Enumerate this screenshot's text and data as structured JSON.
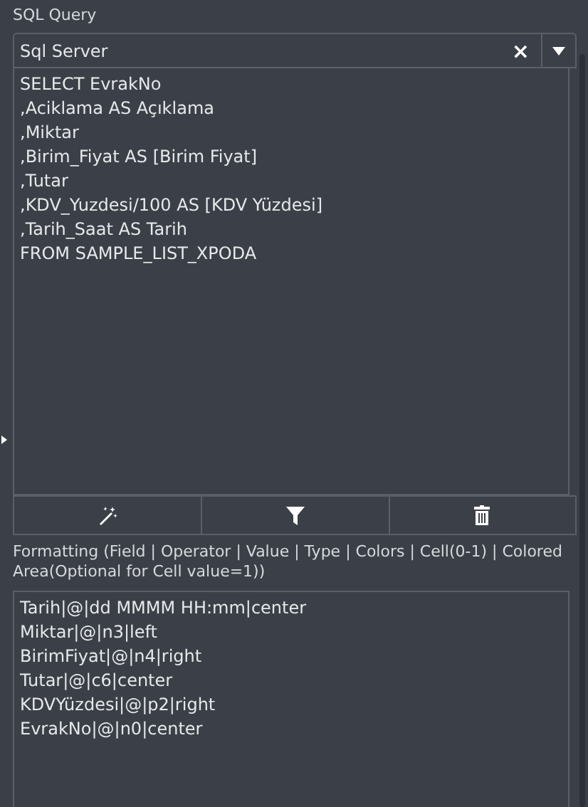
{
  "query_label": "SQL Query",
  "connection": {
    "value": "Sql Server",
    "clear": "×"
  },
  "query_lines": [
    "SELECT EvrakNo",
    ",Aciklama AS Açıklama",
    ",Miktar",
    ",Birim_Fiyat AS [Birim Fiyat]",
    ",Tutar",
    ",KDV_Yuzdesi/100 AS [KDV Yüzdesi]",
    ",Tarih_Saat AS Tarih",
    "FROM SAMPLE_LIST_XPODA"
  ],
  "toolbar": [
    {
      "kind": "wand"
    },
    {
      "kind": "filter"
    },
    {
      "kind": "trash"
    }
  ],
  "formatting_label": "Formatting (Field | Operator | Value | Type | Colors | Cell(0-1) | Colored Area(Optional for Cell value=1))",
  "formatting_lines": [
    "Tarih|@|dd MMMM HH:mm|center",
    "Miktar|@|n3|left",
    "BirimFiyat|@|n4|right",
    "Tutar|@|c6|center",
    "KDVYüzdesi|@|p2|right",
    "EvrakNo|@|n0|center"
  ]
}
